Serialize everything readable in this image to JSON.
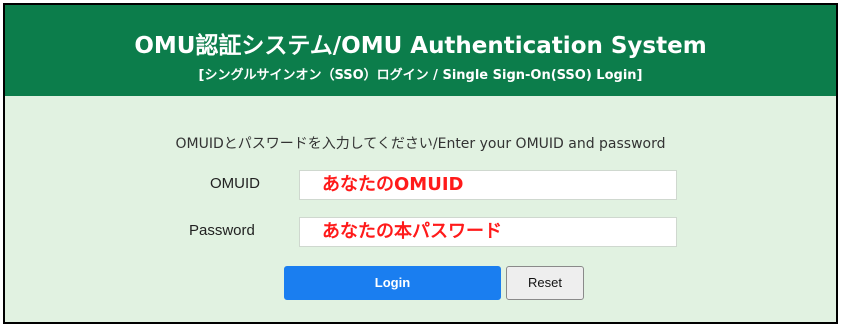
{
  "header": {
    "title": "OMU認証システム/OMU Authentication System",
    "subtitle": "[シングルサインオン（SSO）ログイン / Single Sign-On(SSO) Login]"
  },
  "form": {
    "instruction": "OMUIDとパスワードを入力してください/Enter your OMUID and password",
    "omuid_label": "OMUID",
    "omuid_value": "あなたのOMUID",
    "password_label": "Password",
    "password_value": "あなたの本パスワード",
    "login_label": "Login",
    "reset_label": "Reset"
  },
  "colors": {
    "header_bg": "#0c7d4b",
    "panel_bg": "#e1f2e1",
    "login_bg": "#1a7ef0",
    "input_text": "#ff1a1a"
  }
}
